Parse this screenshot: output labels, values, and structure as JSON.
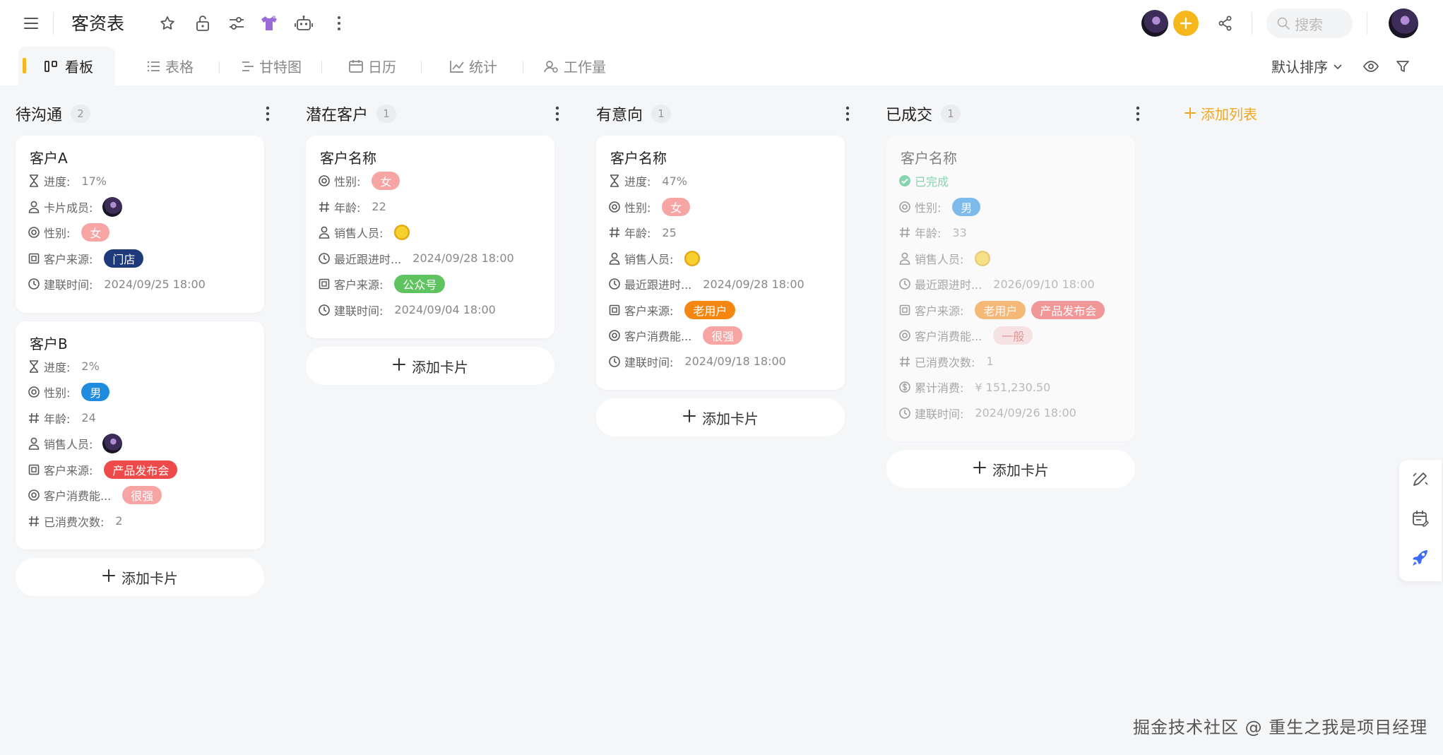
{
  "header": {
    "title": "客资表",
    "search_placeholder": "搜索",
    "icons": [
      "menu-icon",
      "star-icon",
      "unlock-icon",
      "sliders-icon",
      "shirt-icon",
      "robot-icon",
      "more-vertical-icon",
      "plus-icon",
      "share-icon",
      "search-icon"
    ],
    "accent_color": "#f6b71c"
  },
  "view_tabs": [
    {
      "label": "看板",
      "icon": "kanban-icon",
      "active": true
    },
    {
      "label": "表格",
      "icon": "list-icon",
      "active": false
    },
    {
      "label": "甘特图",
      "icon": "gantt-icon",
      "active": false
    },
    {
      "label": "日历",
      "icon": "calendar-icon",
      "active": false
    },
    {
      "label": "统计",
      "icon": "chart-icon",
      "active": false
    },
    {
      "label": "工作量",
      "icon": "workload-icon",
      "active": false
    }
  ],
  "toolbar": {
    "sort_label": "默认排序",
    "add_list_label": "添加列表",
    "add_card_label": "添加卡片"
  },
  "columns": [
    {
      "title": "待沟通",
      "count": "2",
      "cards": [
        {
          "title": "客户A",
          "fields": [
            {
              "icon": "hourglass-icon",
              "label": "进度:",
              "value": "17%"
            },
            {
              "icon": "user-icon",
              "label": "卡片成员:",
              "avatar": true
            },
            {
              "icon": "circle-dot-icon",
              "label": "性别:",
              "tags": [
                {
                  "text": "女",
                  "bg": "#f7a4a4"
                }
              ]
            },
            {
              "icon": "square-icon",
              "label": "客户来源:",
              "tags": [
                {
                  "text": "门店",
                  "bg": "#1f3a7a"
                }
              ]
            },
            {
              "icon": "clock-icon",
              "label": "建联时间:",
              "value": "2024/09/25 18:00"
            }
          ]
        },
        {
          "title": "客户B",
          "fields": [
            {
              "icon": "hourglass-icon",
              "label": "进度:",
              "value": "2%"
            },
            {
              "icon": "circle-dot-icon",
              "label": "性别:",
              "tags": [
                {
                  "text": "男",
                  "bg": "#1f8ce0"
                }
              ]
            },
            {
              "icon": "hash-icon",
              "label": "年龄:",
              "value": "24"
            },
            {
              "icon": "user-icon",
              "label": "销售人员:",
              "avatar": true
            },
            {
              "icon": "square-icon",
              "label": "客户来源:",
              "tags": [
                {
                  "text": "产品发布会",
                  "bg": "#ee4a4a"
                }
              ]
            },
            {
              "icon": "circle-dot-icon",
              "label": "客户消费能...",
              "tags": [
                {
                  "text": "很强",
                  "bg": "#f7a4a4"
                }
              ]
            },
            {
              "icon": "hash-icon",
              "label": "已消费次数:",
              "value": "2"
            }
          ]
        }
      ]
    },
    {
      "title": "潜在客户",
      "count": "1",
      "cards": [
        {
          "title": "客户名称",
          "fields": [
            {
              "icon": "circle-dot-icon",
              "label": "性别:",
              "tags": [
                {
                  "text": "女",
                  "bg": "#f7a4a4"
                }
              ]
            },
            {
              "icon": "hash-icon",
              "label": "年龄:",
              "value": "22"
            },
            {
              "icon": "user-icon",
              "label": "销售人员:",
              "coin": true
            },
            {
              "icon": "clock-icon",
              "label": "最近跟进时...",
              "value": "2024/09/28 18:00"
            },
            {
              "icon": "square-icon",
              "label": "客户来源:",
              "tags": [
                {
                  "text": "公众号",
                  "bg": "#5fc35f"
                }
              ]
            },
            {
              "icon": "clock-icon",
              "label": "建联时间:",
              "value": "2024/09/04 18:00"
            }
          ]
        }
      ]
    },
    {
      "title": "有意向",
      "count": "1",
      "cards": [
        {
          "title": "客户名称",
          "fields": [
            {
              "icon": "hourglass-icon",
              "label": "进度:",
              "value": "47%"
            },
            {
              "icon": "circle-dot-icon",
              "label": "性别:",
              "tags": [
                {
                  "text": "女",
                  "bg": "#f7a4a4"
                }
              ]
            },
            {
              "icon": "hash-icon",
              "label": "年龄:",
              "value": "25"
            },
            {
              "icon": "user-icon",
              "label": "销售人员:",
              "coin": true
            },
            {
              "icon": "clock-icon",
              "label": "最近跟进时...",
              "value": "2024/09/28 18:00"
            },
            {
              "icon": "square-icon",
              "label": "客户来源:",
              "tags": [
                {
                  "text": "老用户",
                  "bg": "#f5860f"
                }
              ]
            },
            {
              "icon": "circle-dot-icon",
              "label": "客户消费能...",
              "tags": [
                {
                  "text": "很强",
                  "bg": "#f7a4a4"
                }
              ]
            },
            {
              "icon": "clock-icon",
              "label": "建联时间:",
              "value": "2024/09/18 18:00"
            }
          ]
        }
      ]
    },
    {
      "title": "已成交",
      "count": "1",
      "cards": [
        {
          "title": "客户名称",
          "faded": true,
          "fields": [
            {
              "icon": "check-circle-icon",
              "label": "已完成",
              "done": true
            },
            {
              "icon": "circle-dot-icon",
              "label": "性别:",
              "tags": [
                {
                  "text": "男",
                  "bg": "#1f8ce0"
                }
              ]
            },
            {
              "icon": "hash-icon",
              "label": "年龄:",
              "value": "33"
            },
            {
              "icon": "user-icon",
              "label": "销售人员:",
              "coin": true
            },
            {
              "icon": "clock-icon",
              "label": "最近跟进时...",
              "value": "2026/09/10 18:00"
            },
            {
              "icon": "square-icon",
              "label": "客户来源:",
              "tags": [
                {
                  "text": "老用户",
                  "bg": "#f5860f"
                },
                {
                  "text": "产品发布会",
                  "bg": "#ee4a4a"
                }
              ]
            },
            {
              "icon": "circle-dot-icon",
              "label": "客户消费能...",
              "tags": [
                {
                  "text": "一般",
                  "bg": "#f9d3d3",
                  "fg": "#c84a4a"
                }
              ]
            },
            {
              "icon": "hash-icon",
              "label": "已消费次数:",
              "value": "1"
            },
            {
              "icon": "dollar-icon",
              "label": "累计消费:",
              "value": "¥ 151,230.50"
            },
            {
              "icon": "clock-icon",
              "label": "建联时间:",
              "value": "2024/09/26 18:00"
            }
          ]
        }
      ]
    }
  ],
  "side_float": [
    "edit-icon",
    "calendar-edit-icon",
    "rocket-icon"
  ],
  "watermark": "掘金技术社区 @ 重生之我是项目经理"
}
